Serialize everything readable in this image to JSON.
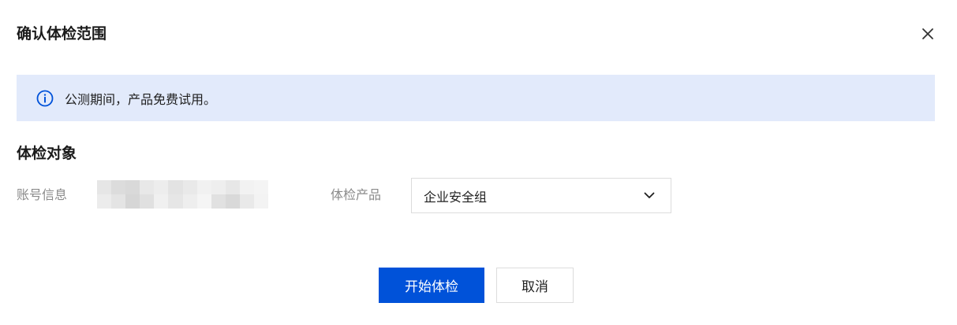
{
  "dialog": {
    "title": "确认体检范围",
    "close_icon": "close-icon"
  },
  "notice": {
    "icon": "info-icon",
    "text": "公测期间，产品免费试用。",
    "background": "#e2eafb",
    "icon_color": "#0052d9"
  },
  "target": {
    "section_title": "体检对象",
    "account_label": "账号信息",
    "account_value_masked": true,
    "product_label": "体检产品",
    "product_selected": "企业安全组",
    "product_dropdown_icon": "chevron-down-icon"
  },
  "footer": {
    "start_label": "开始体检",
    "cancel_label": "取消",
    "primary_color": "#0052d9"
  }
}
